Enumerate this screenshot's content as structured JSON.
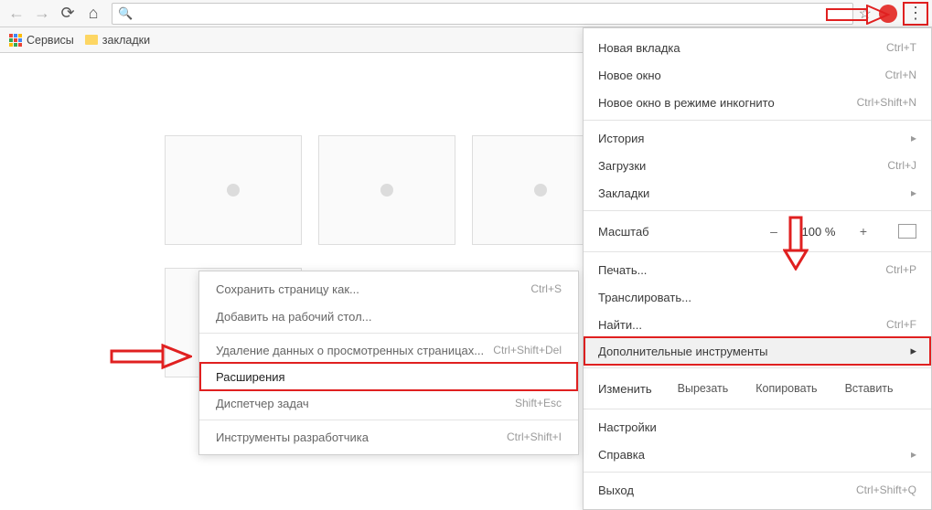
{
  "toolbar": {
    "omnibox_value": "",
    "omnibox_placeholder": ""
  },
  "bookmarks_bar": {
    "apps_label": "Сервисы",
    "folder_label": "закладки"
  },
  "main_menu": {
    "new_tab": "Новая вкладка",
    "new_tab_sc": "Ctrl+T",
    "new_window": "Новое окно",
    "new_window_sc": "Ctrl+N",
    "incognito": "Новое окно в режиме инкогнито",
    "incognito_sc": "Ctrl+Shift+N",
    "history": "История",
    "downloads": "Загрузки",
    "downloads_sc": "Ctrl+J",
    "bookmarks": "Закладки",
    "zoom_label": "Масштаб",
    "zoom_minus": "–",
    "zoom_value": "100 %",
    "zoom_plus": "+",
    "print": "Печать...",
    "print_sc": "Ctrl+P",
    "cast": "Транслировать...",
    "find": "Найти...",
    "find_sc": "Ctrl+F",
    "more_tools": "Дополнительные инструменты",
    "edit_label": "Изменить",
    "cut": "Вырезать",
    "copy": "Копировать",
    "paste": "Вставить",
    "settings": "Настройки",
    "help": "Справка",
    "exit": "Выход",
    "exit_sc": "Ctrl+Shift+Q"
  },
  "submenu": {
    "save_as": "Сохранить страницу как...",
    "save_as_sc": "Ctrl+S",
    "add_desktop": "Добавить на рабочий стол...",
    "clear_data": "Удаление данных о просмотренных страницах...",
    "clear_data_sc": "Ctrl+Shift+Del",
    "extensions": "Расширения",
    "task_mgr": "Диспетчер задач",
    "task_mgr_sc": "Shift+Esc",
    "dev_tools": "Инструменты разработчика",
    "dev_tools_sc": "Ctrl+Shift+I"
  }
}
